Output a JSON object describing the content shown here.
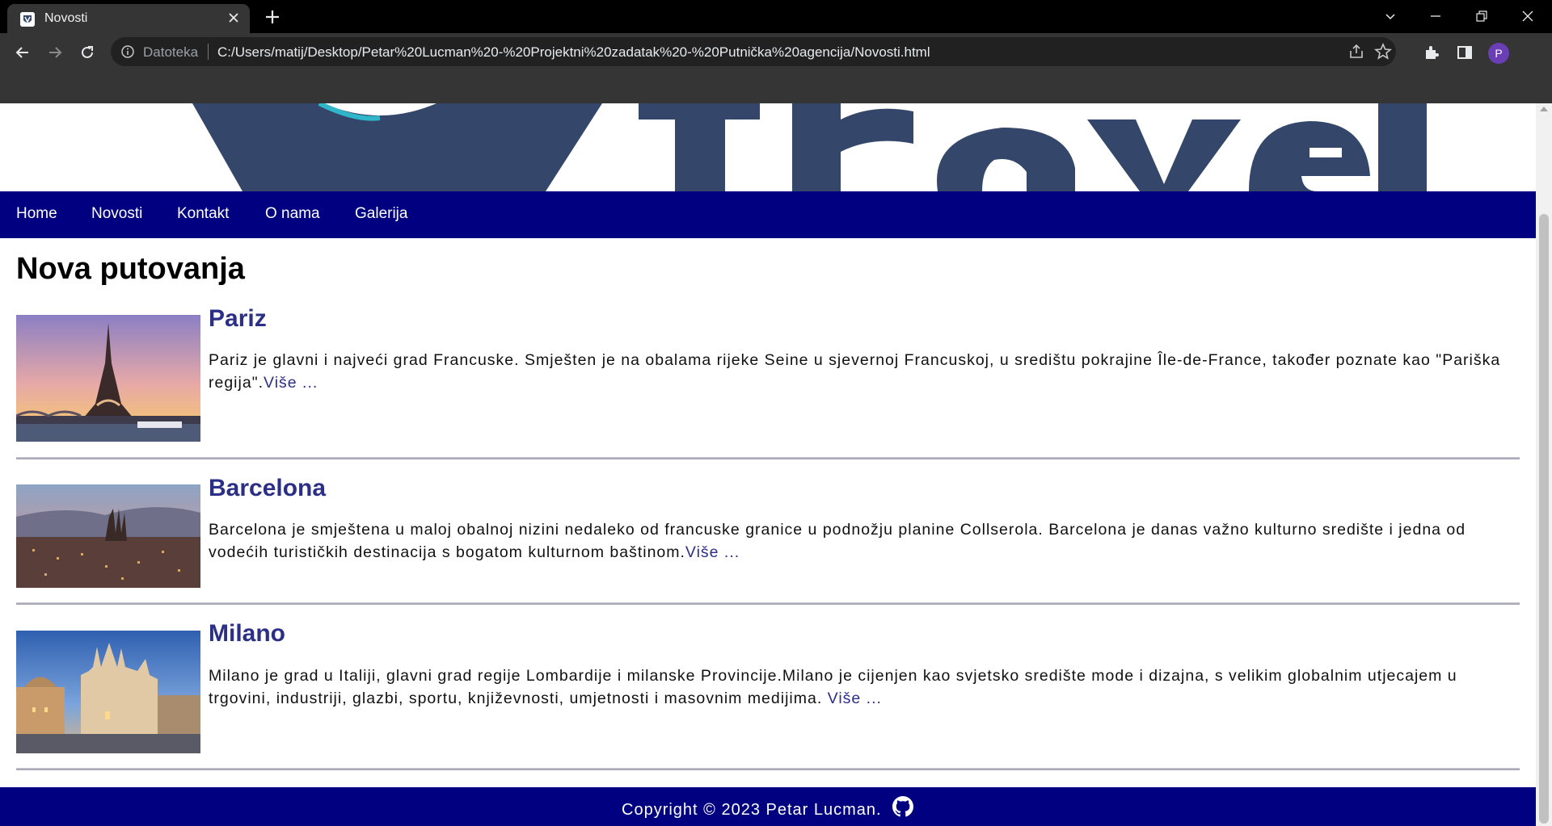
{
  "browser": {
    "tab_title": "Novosti",
    "scheme_label": "Datoteka",
    "url": "C:/Users/matij/Desktop/Petar%20Lucman%20-%20Projektni%20zadatak%20-%20Putnička%20agencija/Novosti.html",
    "profile_initial": "P"
  },
  "nav": {
    "items": [
      {
        "label": "Home"
      },
      {
        "label": "Novosti"
      },
      {
        "label": "Kontakt"
      },
      {
        "label": "O nama"
      },
      {
        "label": "Galerija"
      }
    ]
  },
  "page": {
    "title": "Nova putovanja"
  },
  "articles": [
    {
      "title": "Pariz",
      "text": "Pariz je glavni i najveći grad Francuske. Smješten je na obalama rijeke Seine u sjevernoj Francuskoj, u središtu pokrajine Île-de-France, također poznate kao \"Pariška regija\".",
      "more": "Više ..."
    },
    {
      "title": "Barcelona",
      "text": "Barcelona je smještena u maloj obalnoj nizini nedaleko od francuske granice u podnožju planine Collserola. Barcelona je danas važno kulturno središte i jedna od vodećih turističkih destinacija s bogatom kulturnom baštinom.",
      "more": "Više ..."
    },
    {
      "title": "Milano",
      "text": "Milano je grad u Italiji, glavni grad regije Lombardije i milanske Provincije.Milano je cijenjen kao svjetsko središte mode i dizajna, s velikim globalnim utjecajem u trgovini, industriji, glazbi, sportu, književnosti, umjetnosti i masovnim medijima. ",
      "more": "Više ..."
    }
  ],
  "footer": {
    "text": "Copyright © 2023 Petar Lucman."
  },
  "colors": {
    "nav_bg": "#000080",
    "heading": "#2b2f86",
    "logo": "#34476a"
  },
  "icons": [
    "favicon-icon",
    "close-icon",
    "plus-icon",
    "chevron-down-icon",
    "minimize-icon",
    "restore-icon",
    "back-icon",
    "forward-icon",
    "reload-icon",
    "info-icon",
    "share-icon",
    "star-icon",
    "extensions-icon",
    "side-panel-icon",
    "github-icon"
  ]
}
